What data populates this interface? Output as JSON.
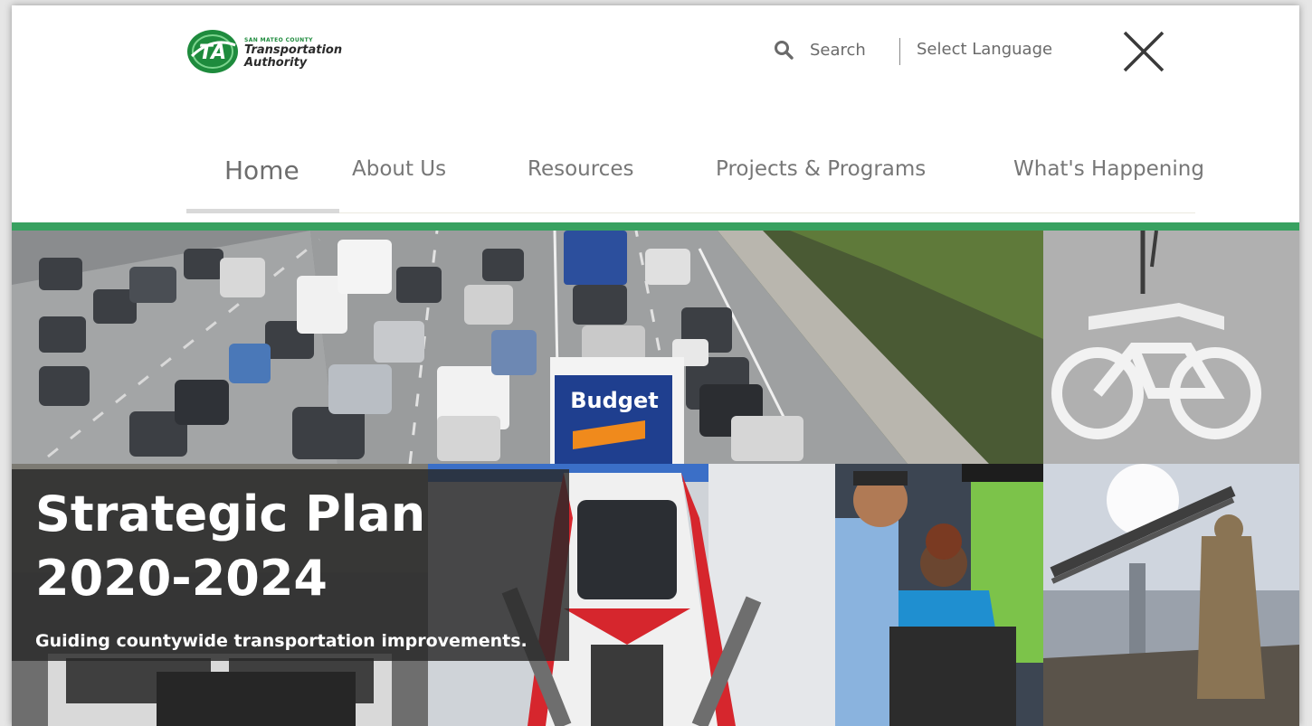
{
  "logo": {
    "mark_text": "TA",
    "county": "SAN MATEO COUNTY",
    "line1": "Transportation",
    "line2": "Authority"
  },
  "header": {
    "search_label": "Search",
    "language_label": "Select Language"
  },
  "nav": {
    "items": [
      {
        "label": "Home",
        "active": true
      },
      {
        "label": "About Us",
        "active": false
      },
      {
        "label": "Resources",
        "active": false
      },
      {
        "label": "Projects & Programs",
        "active": false
      },
      {
        "label": "What's Happening",
        "active": false
      }
    ]
  },
  "hero": {
    "headline_line1": "Strategic Plan",
    "headline_line2": "2020-2024",
    "tagline": "Guiding countywide transportation improvements.",
    "truck_sign": "Budget"
  },
  "colors": {
    "brand_green": "#38a160",
    "logo_green": "#1e8b3d",
    "nav_text": "#777777",
    "overlay": "#282828"
  }
}
